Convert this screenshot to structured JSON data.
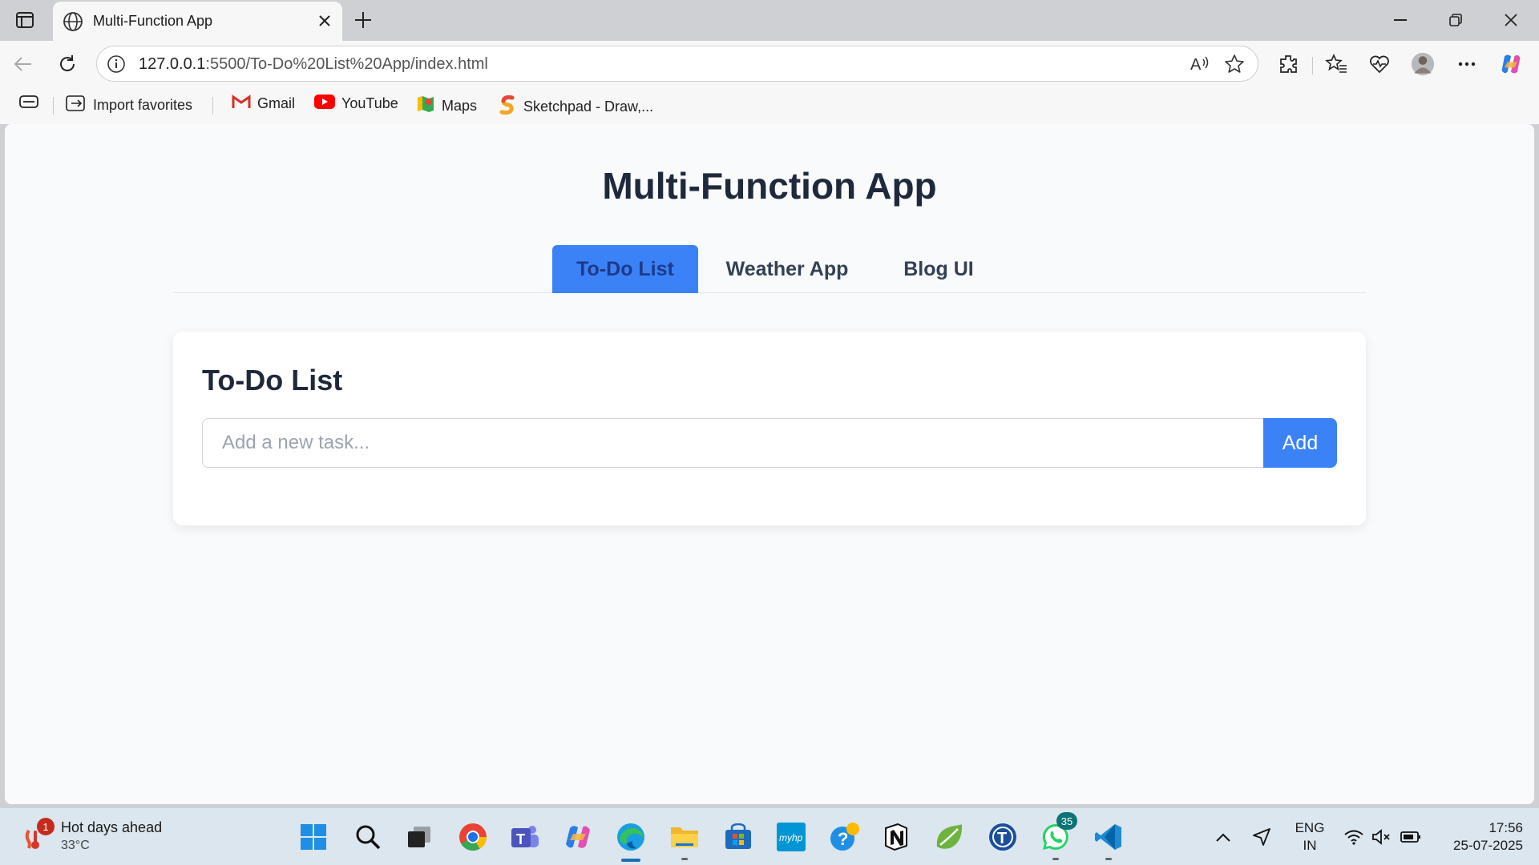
{
  "browser": {
    "tab_title": "Multi-Function App",
    "url_host": "127.0.0.1",
    "url_rest": ":5500/To-Do%20List%20App/index.html"
  },
  "bookmarks": [
    {
      "label": "Import favorites"
    },
    {
      "label": "Gmail"
    },
    {
      "label": "YouTube"
    },
    {
      "label": "Maps"
    },
    {
      "label": "Sketchpad - Draw,..."
    }
  ],
  "page": {
    "title": "Multi-Function App",
    "tabs": [
      {
        "label": "To-Do List",
        "active": true
      },
      {
        "label": "Weather App",
        "active": false
      },
      {
        "label": "Blog UI",
        "active": false
      }
    ],
    "card": {
      "heading": "To-Do List",
      "input_placeholder": "Add a new task...",
      "add_label": "Add"
    }
  },
  "taskbar": {
    "weather_text": "Hot days ahead",
    "weather_temp": "33°C",
    "weather_badge": "1",
    "whatsapp_badge": "35",
    "lang_top": "ENG",
    "lang_bottom": "IN",
    "time": "17:56",
    "date": "25-07-2025"
  },
  "colors": {
    "accent": "#3b82f6",
    "page_bg": "#f8fafc",
    "heading": "#1e293b"
  }
}
